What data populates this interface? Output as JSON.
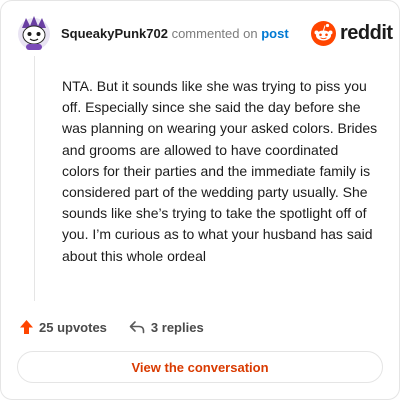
{
  "header": {
    "username": "SqueakyPunk702",
    "action_text": "commented on",
    "post_link": "post",
    "brand": "reddit"
  },
  "comment": {
    "body": "NTA. But it sounds like she was trying to piss you off. Especially since she said the day before she was planning on wearing your asked colors. Brides and grooms are allowed to have coordinated colors for their parties and the immediate family is considered part of the wedding party usually. She sounds like she’s trying to take the spotlight off of you. I’m curious as to what your husband has said about this whole ordeal"
  },
  "actions": {
    "upvotes_label": "25 upvotes",
    "replies_label": "3 replies"
  },
  "cta": {
    "label": "View the conversation"
  },
  "colors": {
    "brand": "#ff4500",
    "link": "#0079d3",
    "cta_text": "#d93a00"
  },
  "icons": {
    "avatar": "snoo-avatar",
    "logo": "reddit-snoo-icon",
    "upvote": "upvote-arrow-icon",
    "reply": "reply-arrow-icon"
  }
}
